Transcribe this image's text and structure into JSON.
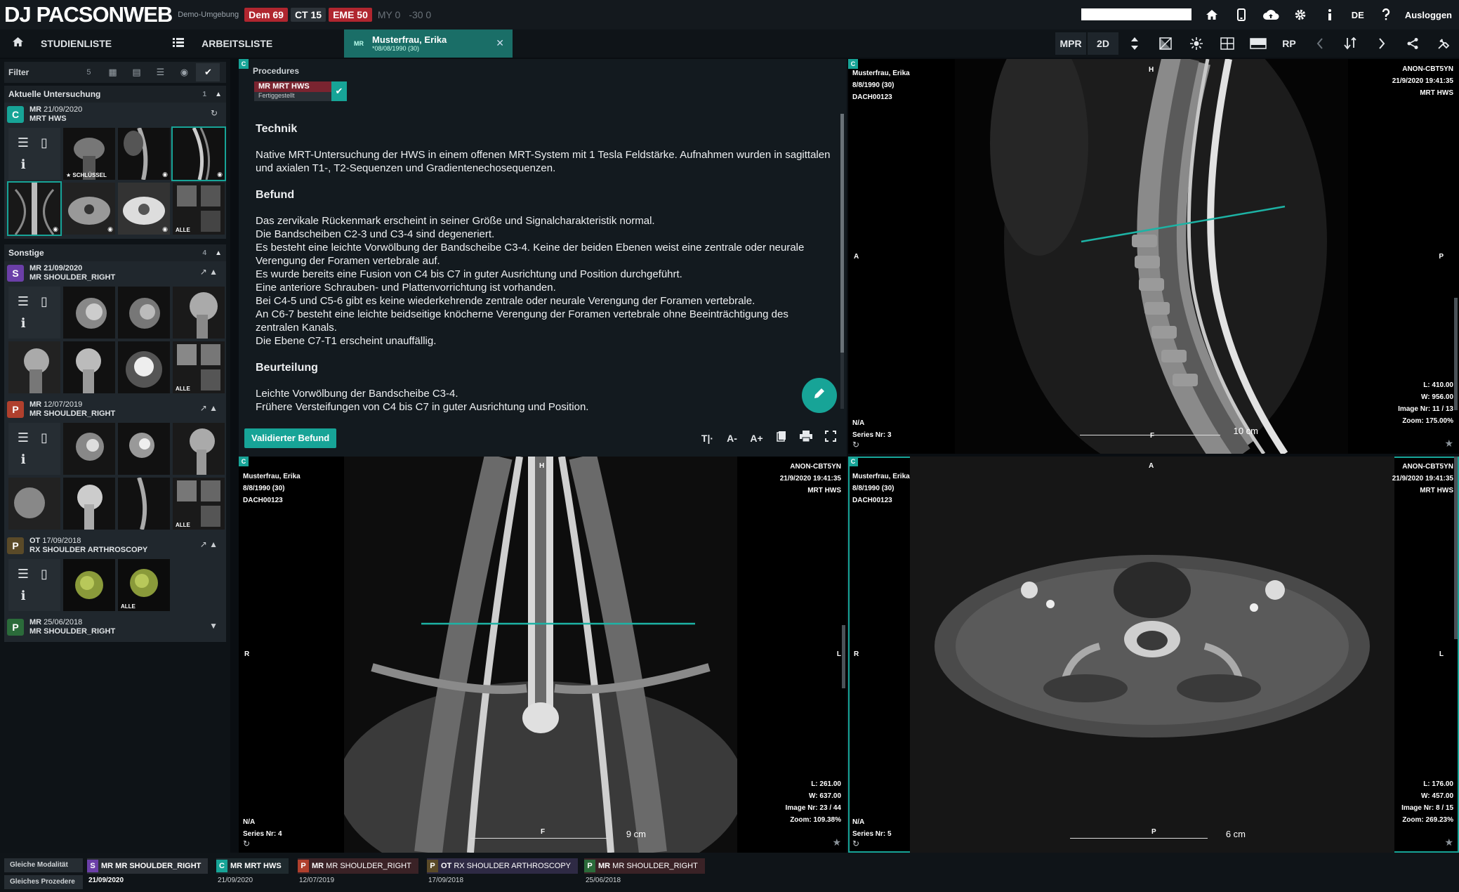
{
  "topbar": {
    "logo": "DJ PACSONWEB",
    "logo_dj": "DJ",
    "logo_name": "PACSONWEB",
    "demo_label": "Demo-Umgebung",
    "badges": [
      {
        "label": "Dem 69",
        "style": "red"
      },
      {
        "label": "CT 15",
        "style": "dark"
      },
      {
        "label": "EME 50",
        "style": "red"
      },
      {
        "label": "MY 0",
        "style": "grey"
      },
      {
        "label": "-30 0",
        "style": "grey"
      }
    ],
    "search_value": "",
    "language": "DE",
    "logout_label": "Ausloggen",
    "icons": [
      "home-icon",
      "mobile-icon",
      "cloud-upload-icon",
      "gear-icon",
      "info-icon"
    ]
  },
  "tabbar": {
    "studylist_label": "STUDIENLISTE",
    "worklist_label": "ARBEITSLISTE",
    "patient_tab": {
      "modality": "MR",
      "name": "Musterfrau, Erika",
      "dob": "*08/08/1990 (30)"
    },
    "tools": [
      "MPR",
      "2D",
      "RP"
    ]
  },
  "sidebar": {
    "filter_label": "Filter",
    "filter_count": "5",
    "sections": [
      {
        "title": "Aktuelle Untersuchung",
        "count": "1",
        "studies": [
          {
            "letter": "C",
            "color": "#17a497",
            "modality": "MR",
            "date": "21/09/2020",
            "desc": "MRT HWS",
            "thumb_captions": [
              "",
              "★ SCHLÜSSEL",
              "",
              "",
              "",
              "",
              "",
              "ALLE"
            ]
          }
        ]
      },
      {
        "title": "Sonstige",
        "count": "4",
        "studies": [
          {
            "letter": "S",
            "color": "#6b3fa8",
            "modality": "MR",
            "date": "21/09/2020",
            "desc": "MR SHOULDER_RIGHT",
            "thumb_captions": [
              "",
              "",
              "",
              "",
              "",
              "",
              "",
              "ALLE"
            ]
          },
          {
            "letter": "P",
            "color": "#b0402d",
            "modality": "MR",
            "date": "12/07/2019",
            "desc": "MR SHOULDER_RIGHT",
            "thumb_captions": [
              "",
              "",
              "",
              "",
              "",
              "",
              "",
              "ALLE"
            ]
          },
          {
            "letter": "P",
            "color": "#5a4a28",
            "modality": "OT",
            "date": "17/09/2018",
            "desc": "RX SHOULDER ARTHROSCOPY",
            "thumb_captions": [
              "",
              "",
              "ALLE"
            ]
          },
          {
            "letter": "P",
            "color": "#2b6b3a",
            "modality": "MR",
            "date": "25/06/2018",
            "desc": "MR SHOULDER_RIGHT",
            "thumb_captions": []
          }
        ]
      }
    ]
  },
  "report": {
    "procedures_label": "Procedures",
    "procedure_name": "MR MRT HWS",
    "procedure_status": "Fertiggestellt",
    "sections": [
      {
        "heading": "Technik",
        "lines": [
          "Native MRT-Untersuchung der HWS in einem offenen MRT-System mit 1 Tesla Feldstärke. Aufnahmen wurden in sagittalen und axialen T1-, T2-Sequenzen und Gradientenechosequenzen."
        ]
      },
      {
        "heading": "Befund",
        "lines": [
          "Das zervikale Rückenmark erscheint in seiner Größe und Signalcharakteristik normal.",
          "Die Bandscheiben C2-3 und C3-4 sind degeneriert.",
          "Es besteht eine leichte Vorwölbung der Bandscheibe C3-4. Keine der beiden Ebenen weist eine zentrale oder neurale Verengung der Foramen vertebrale auf.",
          "Es wurde bereits eine Fusion von C4 bis C7 in guter Ausrichtung und Position durchgeführt.",
          "Eine anteriore Schrauben- und Plattenvorrichtung ist vorhanden.",
          "Bei C4-5 und C5-6 gibt es keine wiederkehrende zentrale oder neurale Verengung der Foramen vertebrale.",
          "An C6-7 besteht eine leichte beidseitige knöcherne Verengung der Foramen vertebrale ohne Beeinträchtigung des zentralen Kanals.",
          "Die Ebene C7-T1 erscheint unauffällig."
        ]
      },
      {
        "heading": "Beurteilung",
        "lines": [
          "Leichte Vorwölbung der Bandscheibe C3-4.",
          "Frühere Versteifungen von C4 bis C7 in guter Ausrichtung und Position."
        ]
      }
    ],
    "validate_label": "Validierter Befund",
    "tools": [
      "T|·",
      "A-",
      "A+"
    ]
  },
  "viewports": [
    {
      "id": "sagittal",
      "patient": "Musterfrau, Erika",
      "dob": "8/8/1990 (30)",
      "pid": "DACH00123",
      "anon": "ANON-CBT5YN",
      "datetime": "21/9/2020 19:41:35",
      "study": "MRT HWS",
      "level": "L: 410.00",
      "width": "W: 956.00",
      "image": "Image Nr: 11 / 13",
      "zoom": "Zoom: 175.00%",
      "na": "N/A",
      "series": "Series Nr: 3",
      "scale": "10 cm",
      "ori_top": "H",
      "ori_left": "A",
      "ori_right": "P",
      "ori_bottom": "F"
    },
    {
      "id": "coronal",
      "patient": "Musterfrau, Erika",
      "dob": "8/8/1990 (30)",
      "pid": "DACH00123",
      "anon": "ANON-CBT5YN",
      "datetime": "21/9/2020 19:41:35",
      "study": "MRT HWS",
      "level": "L: 261.00",
      "width": "W: 637.00",
      "image": "Image Nr: 23 / 44",
      "zoom": "Zoom: 109.38%",
      "na": "N/A",
      "series": "Series Nr: 4",
      "scale": "9 cm",
      "ori_top": "H",
      "ori_left": "R",
      "ori_right": "L",
      "ori_bottom": "F"
    },
    {
      "id": "axial",
      "patient": "Musterfrau, Erika",
      "dob": "8/8/1990 (30)",
      "pid": "DACH00123",
      "anon": "ANON-CBT5YN",
      "datetime": "21/9/2020 19:41:35",
      "study": "MRT HWS",
      "level": "L: 176.00",
      "width": "W: 457.00",
      "image": "Image Nr: 8 / 15",
      "zoom": "Zoom: 269.23%",
      "na": "N/A",
      "series": "Series Nr: 5",
      "scale": "6 cm",
      "ori_top": "A",
      "ori_left": "R",
      "ori_right": "L",
      "ori_bottom": "P"
    }
  ],
  "bottombar": {
    "same_modality": "Gleiche Modalität",
    "same_procedure": "Gleiches Prozedere",
    "items": [
      {
        "letter": "S",
        "color": "#6b3fa8",
        "modality": "MR",
        "desc": "MR SHOULDER_RIGHT",
        "date": "21/09/2020"
      },
      {
        "letter": "C",
        "color": "#17a497",
        "modality": "MR",
        "desc": "MRT HWS",
        "date": "21/09/2020"
      },
      {
        "letter": "P",
        "color": "#b0402d",
        "modality": "MR",
        "desc": "MR SHOULDER_RIGHT",
        "date": "12/07/2019"
      },
      {
        "letter": "P",
        "color": "#5a4a28",
        "modality": "OT",
        "desc": "RX SHOULDER ARTHROSCOPY",
        "date": "17/09/2018"
      },
      {
        "letter": "P",
        "color": "#2b6b3a",
        "modality": "MR",
        "desc": "MR SHOULDER_RIGHT",
        "date": "25/06/2018"
      }
    ]
  },
  "colors": {
    "accent": "#17a497",
    "alert": "#b0262f"
  }
}
